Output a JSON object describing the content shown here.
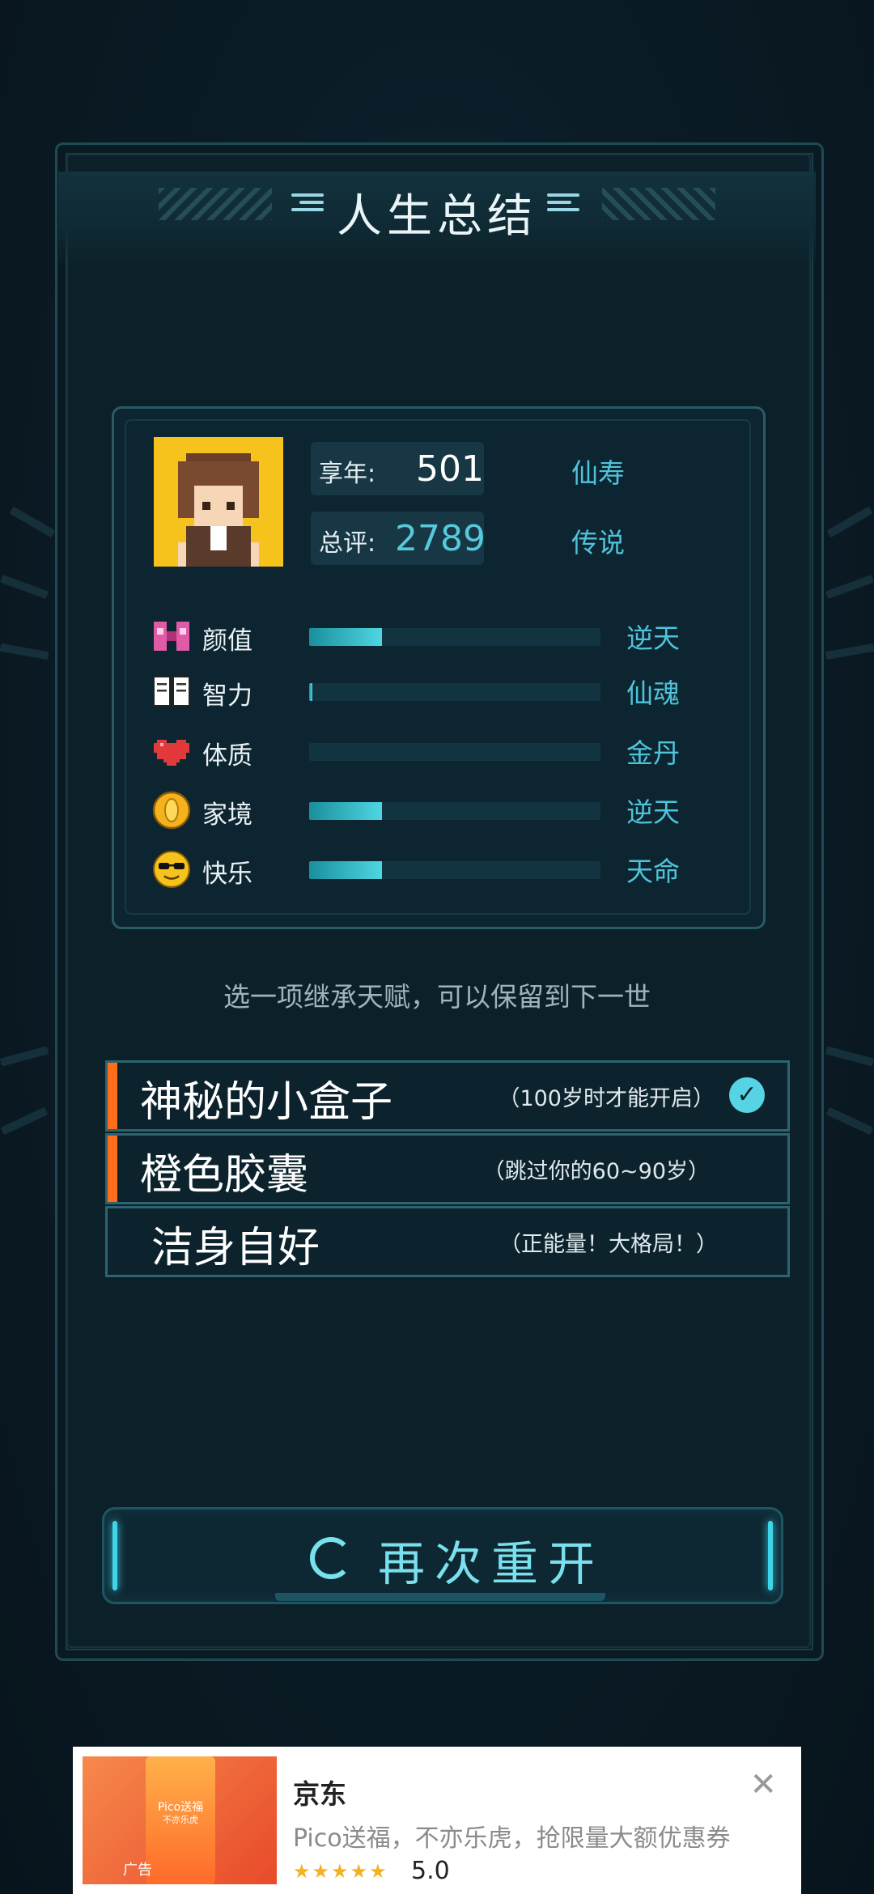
{
  "title": "人生总结",
  "summary": {
    "age_label": "享年:",
    "age_value": "501",
    "age_rank": "仙寿",
    "score_label": "总评:",
    "score_value": "2789",
    "score_rank": "传说"
  },
  "attributes": [
    {
      "icon": "bow-icon",
      "name": "颜值",
      "level": 0.25,
      "rank": "逆天"
    },
    {
      "icon": "book-icon",
      "name": "智力",
      "level": 0.01,
      "rank": "仙魂"
    },
    {
      "icon": "heart-icon",
      "name": "体质",
      "level": 0.0,
      "rank": "金丹"
    },
    {
      "icon": "coin-icon",
      "name": "家境",
      "level": 0.25,
      "rank": "逆天"
    },
    {
      "icon": "sunglasses-face-icon",
      "name": "快乐",
      "level": 0.25,
      "rank": "天命"
    }
  ],
  "hint": "选一项继承天赋，可以保留到下一世",
  "talents": [
    {
      "name": "神秘的小盒子",
      "desc": "（100岁时才能开启）",
      "selected": true,
      "accent": "#ff6d1a"
    },
    {
      "name": "橙色胶囊",
      "desc": "（跳过你的60~90岁）",
      "selected": false,
      "accent": "#ff6d1a"
    },
    {
      "name": "洁身自好",
      "desc": "（正能量！大格局！）",
      "selected": false,
      "accent": null
    }
  ],
  "restart_label": "再次重开",
  "ad": {
    "title": "京东",
    "description": "Pico送福，不亦乐虎，抢限量大额优惠券",
    "rating": "5.0",
    "tag": "广告",
    "image_text_1": "Pico送福",
    "image_text_2": "不亦乐虎"
  },
  "colors": {
    "accent_cyan": "#4fc3da",
    "talent_accent": "#ff6d1a",
    "background": "#0a1a24"
  }
}
